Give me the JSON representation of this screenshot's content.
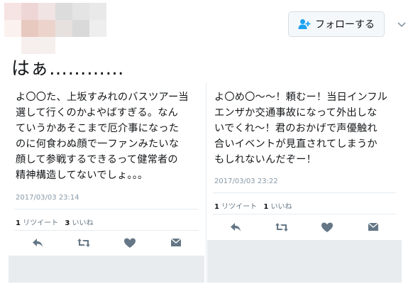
{
  "header": {
    "follow_label": "フォローする",
    "headline": "はぁ…………"
  },
  "tweets": [
    {
      "text": "よ〇〇た、上坂すみれのバスツアー当\n選して行くのかよやばすぎる。なん\nていうかあそこまで厄介事になった\nのに何食わぬ顔で一ファンみたいな\n顔して参戦するできるって健常者の\n精神構造してないでしょ。。。",
      "time": "2017/03/03 23:14",
      "retweet_count": "1",
      "retweet_label": "リツイート",
      "like_count": "3",
      "like_label": "いいね"
    },
    {
      "text": "よ〇め〇〜〜！頼むー！当日インフル\nエンザか交通事故になって外出しな\nいでくれ〜！君のおかげで声優触れ\n合いイベントが見直されてしまうか\nもしれないんだぞー！",
      "time": "2017/03/03 23:22",
      "retweet_count": "1",
      "retweet_label": "リツイート",
      "like_count": "1",
      "like_label": "いいね"
    }
  ],
  "icons": [
    "follow-user-icon",
    "caret-down-icon",
    "reply-icon",
    "retweet-icon",
    "heart-icon",
    "message-icon"
  ],
  "colors": {
    "action_icon": "#657786",
    "follow_icon": "#1da1f2",
    "strip": "#e8ecef"
  }
}
